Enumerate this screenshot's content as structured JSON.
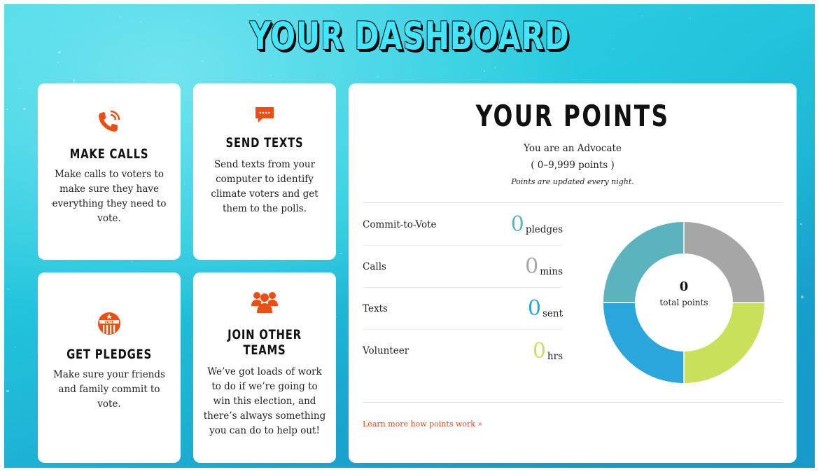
{
  "title": "YOUR DASHBOARD",
  "cards": {
    "calls": {
      "icon": "phone-icon",
      "title": "MAKE CALLS",
      "text": "Make calls to voters to make sure they have everything they need to vote."
    },
    "texts": {
      "icon": "chat-bubble-icon",
      "title": "SEND TEXTS",
      "text": "Send texts from your computer to identify climate voters and get them to the polls."
    },
    "pledges": {
      "icon": "vote-badge-icon",
      "title": "GET PLEDGES",
      "text": "Make sure your friends and family commit to vote."
    },
    "teams": {
      "icon": "group-icon",
      "title": "JOIN OTHER TEAMS",
      "text": "We’ve got loads of work to do if we’re going to win this election, and there’s always something you can do to help out!"
    }
  },
  "points": {
    "title": "YOUR POINTS",
    "level_text": "You are an Advocate",
    "range_text": "( 0–9,999 points )",
    "update_note": "Points are updated every night.",
    "stats": [
      {
        "label": "Commit-to-Vote",
        "value": "0",
        "unit": "pledges",
        "color": "#5bb4bd"
      },
      {
        "label": "Calls",
        "value": "0",
        "unit": "mins",
        "color": "#a6a6a6"
      },
      {
        "label": "Texts",
        "value": "0",
        "unit": "sent",
        "color": "#2aa6dc"
      },
      {
        "label": "Volunteer",
        "value": "0",
        "unit": "hrs",
        "color": "#c9e05a"
      }
    ],
    "total_value": "0",
    "total_label": "total points",
    "learn_more": "Learn more how points work »"
  },
  "colors": {
    "accent_orange": "#ef4e12",
    "donut_teal": "#5bb4bd",
    "donut_gray": "#a6a6a6",
    "donut_lime": "#c9e05a",
    "donut_blue": "#2aa6dc"
  }
}
